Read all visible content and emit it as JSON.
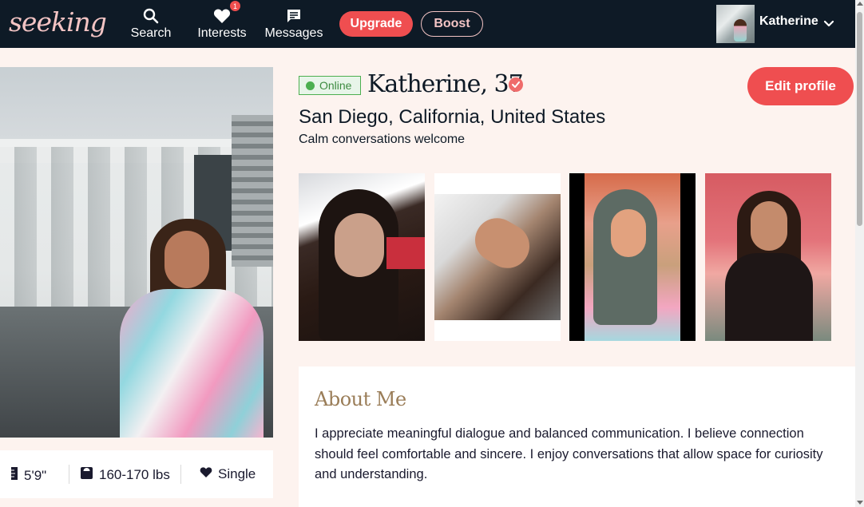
{
  "nav": {
    "logo": "seeking",
    "items": [
      {
        "label": "Search",
        "icon": "search-icon"
      },
      {
        "label": "Interests",
        "icon": "heart-icon",
        "badge": "1"
      },
      {
        "label": "Messages",
        "icon": "message-icon"
      }
    ],
    "upgrade_label": "Upgrade",
    "boost_label": "Boost",
    "user_name": "Katherine"
  },
  "profile": {
    "status": "Online",
    "name_age": "Katherine, 37",
    "verified": true,
    "edit_label": "Edit profile",
    "location": "San Diego, California, United States",
    "tagline": "Calm conversations welcome",
    "photo_count": 4
  },
  "stats": {
    "height": "5'9\"",
    "weight": "160-170 lbs",
    "relationship": "Single"
  },
  "about": {
    "title": "About Me",
    "text": "I appreciate meaningful dialogue and balanced communication. I believe connection should feel comfortable and sincere. I enjoy conversations that allow space for curiosity and understanding."
  },
  "colors": {
    "nav_bg": "#0e1a26",
    "accent": "#ef4e50",
    "page_bg": "#fdf3ef",
    "logo": "#f3c4c4",
    "about_title": "#9a7d58",
    "online": "#4caf50"
  }
}
